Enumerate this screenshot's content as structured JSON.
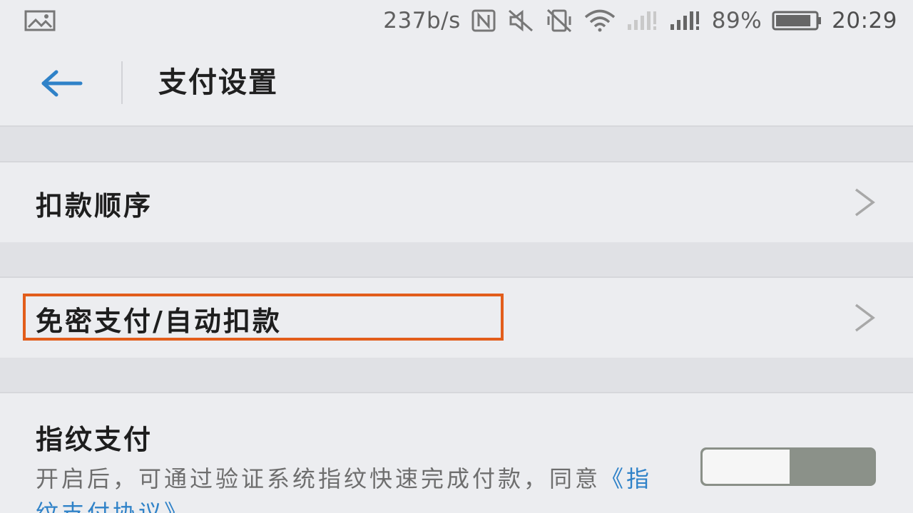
{
  "status_bar": {
    "network_speed": "237b/s",
    "battery_percent": "89%",
    "battery_level": 0.89,
    "time": "20:29",
    "icons": [
      "gallery-icon",
      "nfc-icon",
      "mute-icon",
      "vibrate-off-icon",
      "wifi-icon",
      "signal-weak-icon",
      "signal-strong-icon",
      "battery-icon"
    ]
  },
  "header": {
    "title": "支付设置",
    "back_icon": "back-arrow-icon"
  },
  "settings": {
    "items": [
      {
        "label": "扣款顺序",
        "icon": "chevron-right-icon"
      },
      {
        "label": "免密支付/自动扣款",
        "icon": "chevron-right-icon",
        "highlighted": true
      }
    ],
    "fingerprint": {
      "title": "指纹支付",
      "description": "开启后，可通过验证系统指纹快速完成付款，同意",
      "link_text": "《指纹支付协议》",
      "toggle_on": false
    }
  },
  "colors": {
    "background": "#ecedf0",
    "accent_blue": "#2f82c8",
    "highlight_orange": "#e25d1b",
    "toggle_gray": "#8b9189"
  }
}
